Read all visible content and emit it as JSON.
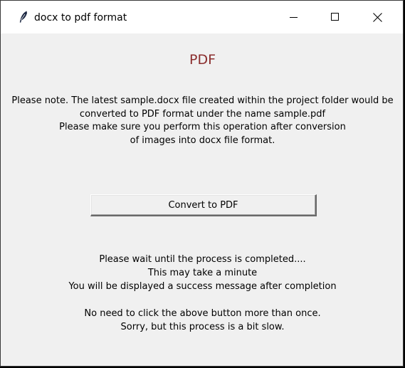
{
  "window": {
    "title": "docx to pdf format",
    "app_icon": "feather-icon",
    "controls": [
      "minimize-icon",
      "maximize-icon",
      "close-icon"
    ]
  },
  "main": {
    "heading": "PDF",
    "heading_color": "#8b2e2e",
    "note_lines": [
      "Please note. The latest sample.docx file created within the project folder would be",
      "converted to PDF format under the name sample.pdf",
      "Please make sure you perform this operation after conversion",
      "of images into docx file format."
    ],
    "convert_button_label": "Convert to PDF",
    "status_lines": [
      "Please wait until the process is completed....",
      "This may take a minute",
      "You will be displayed a success message after completion"
    ],
    "warning_lines": [
      "No need to click the above button more than once.",
      "Sorry, but this process is a bit slow."
    ]
  }
}
